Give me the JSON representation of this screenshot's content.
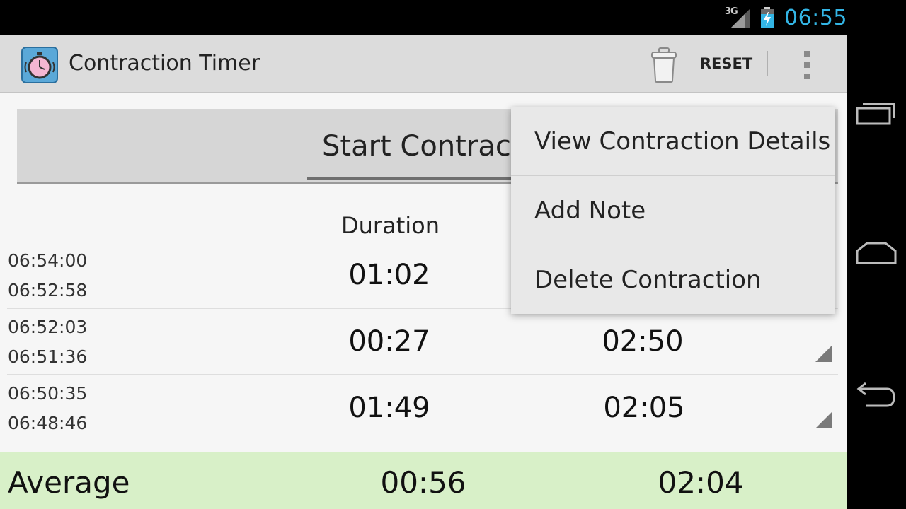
{
  "status_bar": {
    "network": "3G",
    "clock": "06:55",
    "colors": {
      "clock": "#33b5e5",
      "battery_accent": "#33b5e5"
    }
  },
  "action_bar": {
    "app_icon": "stopwatch-icon",
    "title": "Contraction Timer",
    "trash_icon": "trash-icon",
    "reset_label": "RESET",
    "overflow_icon": "overflow-menu-icon"
  },
  "main": {
    "start_button_label": "Start Contractio",
    "headers": {
      "duration": "Duration"
    },
    "rows": [
      {
        "start": "06:54:00",
        "end": "06:52:58",
        "duration": "01:02",
        "frequency": ""
      },
      {
        "start": "06:52:03",
        "end": "06:51:36",
        "duration": "00:27",
        "frequency": "02:50"
      },
      {
        "start": "06:50:35",
        "end": "06:48:46",
        "duration": "01:49",
        "frequency": "02:05"
      }
    ],
    "average": {
      "label": "Average",
      "duration": "00:56",
      "frequency": "02:04"
    },
    "colors": {
      "average_bg": "#d8f0c8"
    }
  },
  "context_menu": {
    "items": [
      {
        "label": "View Contraction Details"
      },
      {
        "label": "Add Note"
      },
      {
        "label": "Delete Contraction"
      }
    ]
  },
  "nav_bar": {
    "recents_icon": "recent-apps-icon",
    "home_icon": "home-icon",
    "back_icon": "back-icon"
  }
}
